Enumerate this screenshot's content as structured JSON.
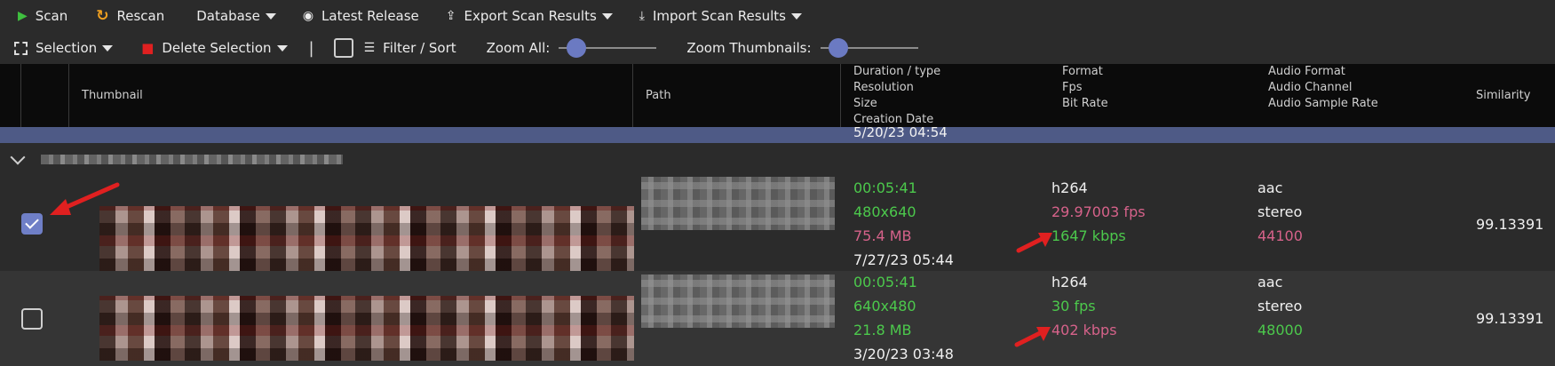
{
  "toolbar1": {
    "scan": "Scan",
    "rescan": "Rescan",
    "database": "Database",
    "latest_release": "Latest Release",
    "export": "Export Scan Results",
    "import": "Import Scan Results"
  },
  "toolbar2": {
    "selection": "Selection",
    "delete_selection": "Delete Selection",
    "separator": "|",
    "filter_sort": "Filter / Sort",
    "zoom_all": "Zoom All:",
    "zoom_all_level": 0.1,
    "zoom_thumbnails": "Zoom Thumbnails:",
    "zoom_thumbnails_level": 0.1
  },
  "columns": {
    "thumbnail": "Thumbnail",
    "path": "Path",
    "duration_type": "Duration / type",
    "resolution": "Resolution",
    "size": "Size",
    "creation_date": "Creation Date",
    "format": "Format",
    "fps": "Fps",
    "bit_rate": "Bit Rate",
    "audio_format": "Audio Format",
    "audio_channel": "Audio Channel",
    "audio_sample_rate": "Audio Sample Rate",
    "similarity": "Similarity"
  },
  "prev_row_date": "5/20/23 04:54",
  "rows": [
    {
      "checked": true,
      "duration": "00:05:41",
      "resolution": "480x640",
      "size": "75.4 MB",
      "creation_date": "7/27/23 05:44",
      "format": "h264",
      "fps": "29.97003 fps",
      "bit_rate": "1647 kbps",
      "audio_format": "aac",
      "audio_channel": "stereo",
      "audio_sample_rate": "44100",
      "similarity": "99.13391"
    },
    {
      "checked": false,
      "duration": "00:05:41",
      "resolution": "640x480",
      "size": "21.8 MB",
      "creation_date": "3/20/23 03:48",
      "format": "h264",
      "fps": "30 fps",
      "bit_rate": "402 kbps",
      "audio_format": "aac",
      "audio_channel": "stereo",
      "audio_sample_rate": "48000",
      "similarity": "99.13391"
    }
  ],
  "colors": {
    "accent": "#6b7ac2",
    "better": "#4cc94c",
    "worse": "#d6628a",
    "arrow": "#e02020"
  }
}
